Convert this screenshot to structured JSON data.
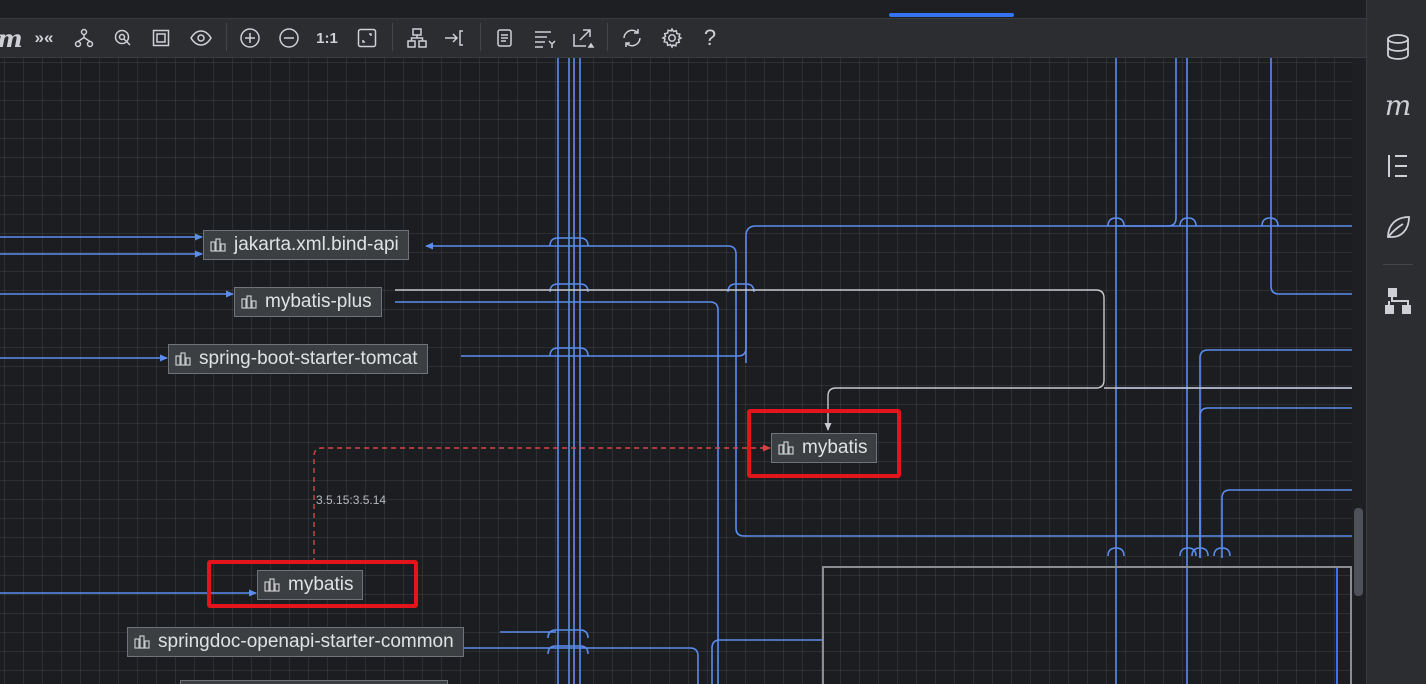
{
  "toolbar": {
    "buttons": [
      {
        "name": "maven-logo-button",
        "label": "m"
      },
      {
        "name": "expand-collapse-button",
        "label": "»«"
      },
      {
        "name": "show-dependencies-button",
        "label": ""
      },
      {
        "name": "select-button",
        "label": ""
      },
      {
        "name": "fit-content-button",
        "label": ""
      },
      {
        "name": "visibility-button",
        "label": ""
      },
      {
        "name": "zoom-in-button",
        "label": ""
      },
      {
        "name": "zoom-out-button",
        "label": ""
      },
      {
        "name": "actual-size-button",
        "label": "1:1"
      },
      {
        "name": "fit-page-button",
        "label": ""
      },
      {
        "name": "layout-button",
        "label": ""
      },
      {
        "name": "route-edges-button",
        "label": ""
      },
      {
        "name": "copy-button",
        "label": ""
      },
      {
        "name": "filter-button",
        "label": ""
      },
      {
        "name": "export-button",
        "label": ""
      },
      {
        "name": "refresh-button",
        "label": ""
      },
      {
        "name": "settings-button",
        "label": ""
      },
      {
        "name": "help-button",
        "label": "?"
      }
    ]
  },
  "nodes": [
    {
      "label": "jakarta.xml.bind-api"
    },
    {
      "label": "mybatis-plus"
    },
    {
      "label": "spring-boot-starter-tomcat"
    },
    {
      "label": "mybatis"
    },
    {
      "label": "mybatis"
    },
    {
      "label": "springdoc-openapi-starter-common"
    }
  ],
  "edge_labels": {
    "version_conflict": "3.5.15:3.5.14"
  },
  "colors": {
    "edge": "#5b8def",
    "conflict_edge": "#d64545",
    "highlight": "#e3151b",
    "accent": "#3574f0"
  },
  "rightbar": [
    {
      "name": "database-icon"
    },
    {
      "name": "maven-icon",
      "label": "m"
    },
    {
      "name": "structure-icon"
    },
    {
      "name": "leaf-icon"
    },
    {
      "name": "diagram-icon"
    }
  ]
}
